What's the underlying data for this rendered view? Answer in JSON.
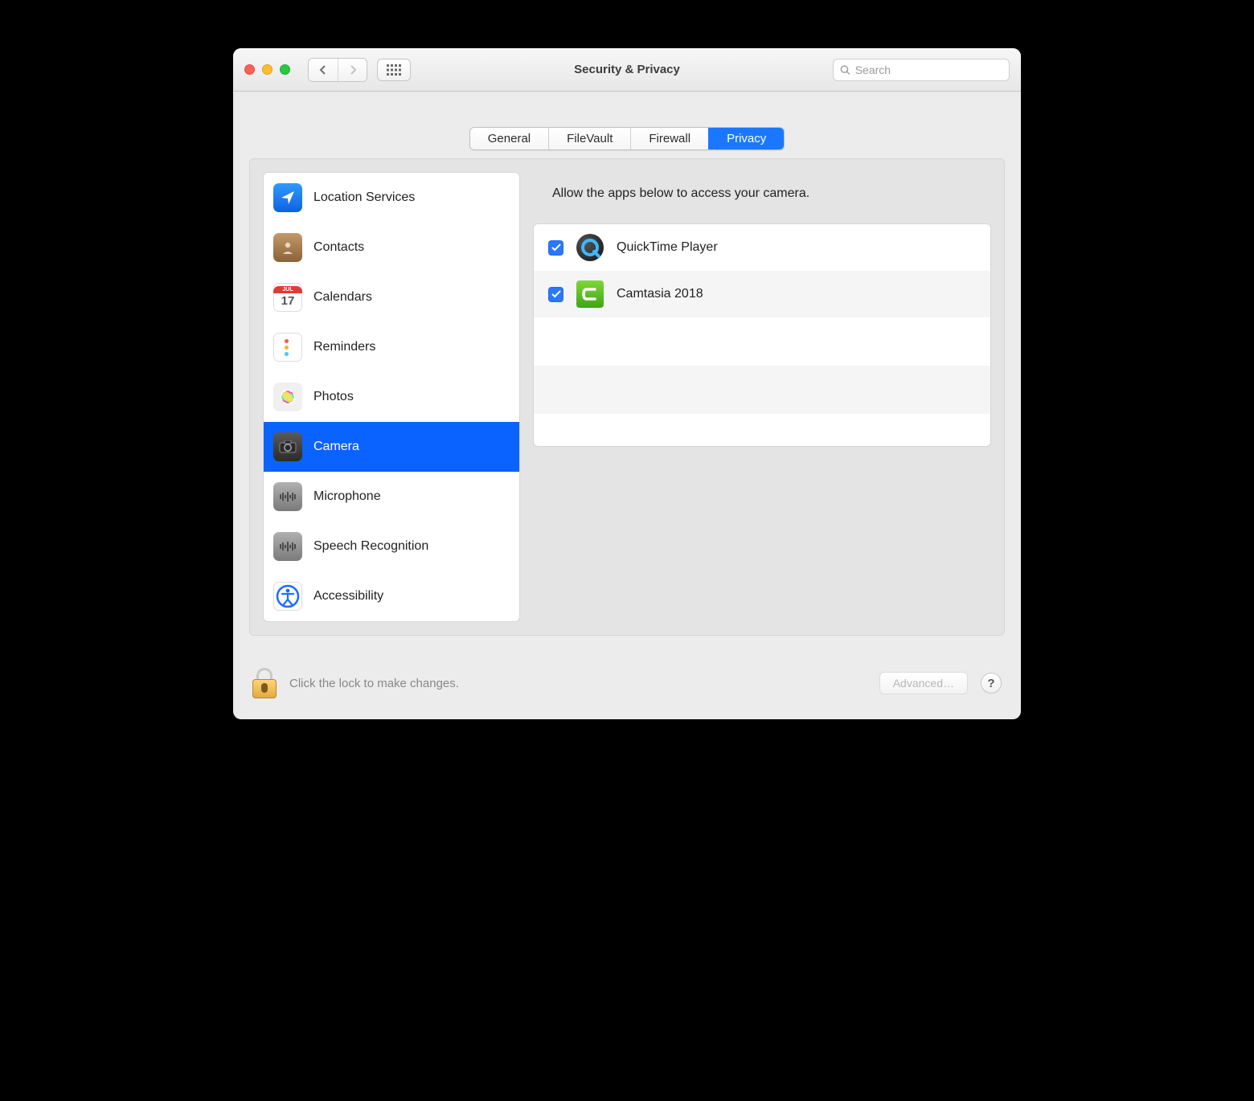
{
  "window": {
    "title": "Security & Privacy"
  },
  "search": {
    "placeholder": "Search"
  },
  "tabs": [
    {
      "label": "General",
      "active": false
    },
    {
      "label": "FileVault",
      "active": false
    },
    {
      "label": "Firewall",
      "active": false
    },
    {
      "label": "Privacy",
      "active": true
    }
  ],
  "sidebar": {
    "items": [
      {
        "label": "Location Services",
        "icon": "location-icon",
        "selected": false
      },
      {
        "label": "Contacts",
        "icon": "contacts-icon",
        "selected": false
      },
      {
        "label": "Calendars",
        "icon": "calendar-icon",
        "selected": false
      },
      {
        "label": "Reminders",
        "icon": "reminders-icon",
        "selected": false
      },
      {
        "label": "Photos",
        "icon": "photos-icon",
        "selected": false
      },
      {
        "label": "Camera",
        "icon": "camera-icon",
        "selected": true
      },
      {
        "label": "Microphone",
        "icon": "microphone-icon",
        "selected": false
      },
      {
        "label": "Speech Recognition",
        "icon": "speech-icon",
        "selected": false
      },
      {
        "label": "Accessibility",
        "icon": "accessibility-icon",
        "selected": false
      }
    ]
  },
  "detail": {
    "heading": "Allow the apps below to access your camera.",
    "apps": [
      {
        "name": "QuickTime Player",
        "checked": true,
        "icon": "quicktime-icon"
      },
      {
        "name": "Camtasia 2018",
        "checked": true,
        "icon": "camtasia-icon"
      }
    ]
  },
  "footer": {
    "lock_hint": "Click the lock to make changes.",
    "advanced_label": "Advanced…",
    "help_label": "?"
  },
  "calendar_icon": {
    "month": "JUL",
    "day": "17"
  }
}
